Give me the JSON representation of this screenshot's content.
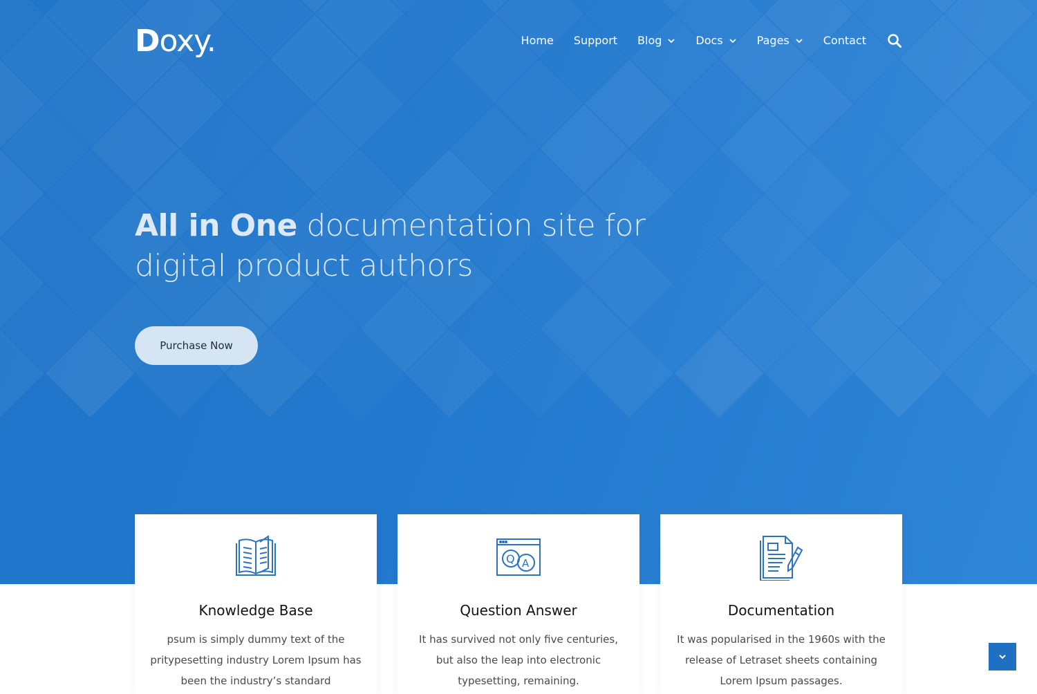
{
  "colors": {
    "hero_blue": "#2178cd",
    "accent": "#1f6fc2",
    "button_bg": "#d6e5f4",
    "icon_stroke": "#2a72c4"
  },
  "header": {
    "logo_initial": "D",
    "logo_rest": "oxy.",
    "nav": [
      {
        "label": "Home",
        "dropdown": false
      },
      {
        "label": "Support",
        "dropdown": false
      },
      {
        "label": "Blog",
        "dropdown": true
      },
      {
        "label": "Docs",
        "dropdown": true
      },
      {
        "label": "Pages",
        "dropdown": true
      },
      {
        "label": "Contact",
        "dropdown": false
      }
    ],
    "search_icon": "search-icon"
  },
  "hero": {
    "headline_strong": "All in One",
    "headline_rest": " documentation site for digital product authors",
    "cta_label": "Purchase Now"
  },
  "features": [
    {
      "icon": "open-book-icon",
      "title": "Knowledge Base",
      "description": "psum is simply dummy text of the pritypesetting industry Lorem Ipsum has been the industry’s standard"
    },
    {
      "icon": "question-answer-icon",
      "title": "Question Answer",
      "description": "It has survived not only five centuries, but also the leap into electronic typesetting, remaining."
    },
    {
      "icon": "document-pen-icon",
      "title": "Documentation",
      "description": "It was popularised in the 1960s with the release of Letraset sheets containing Lorem Ipsum passages."
    }
  ],
  "scroll_icon": "chevron-down-icon"
}
